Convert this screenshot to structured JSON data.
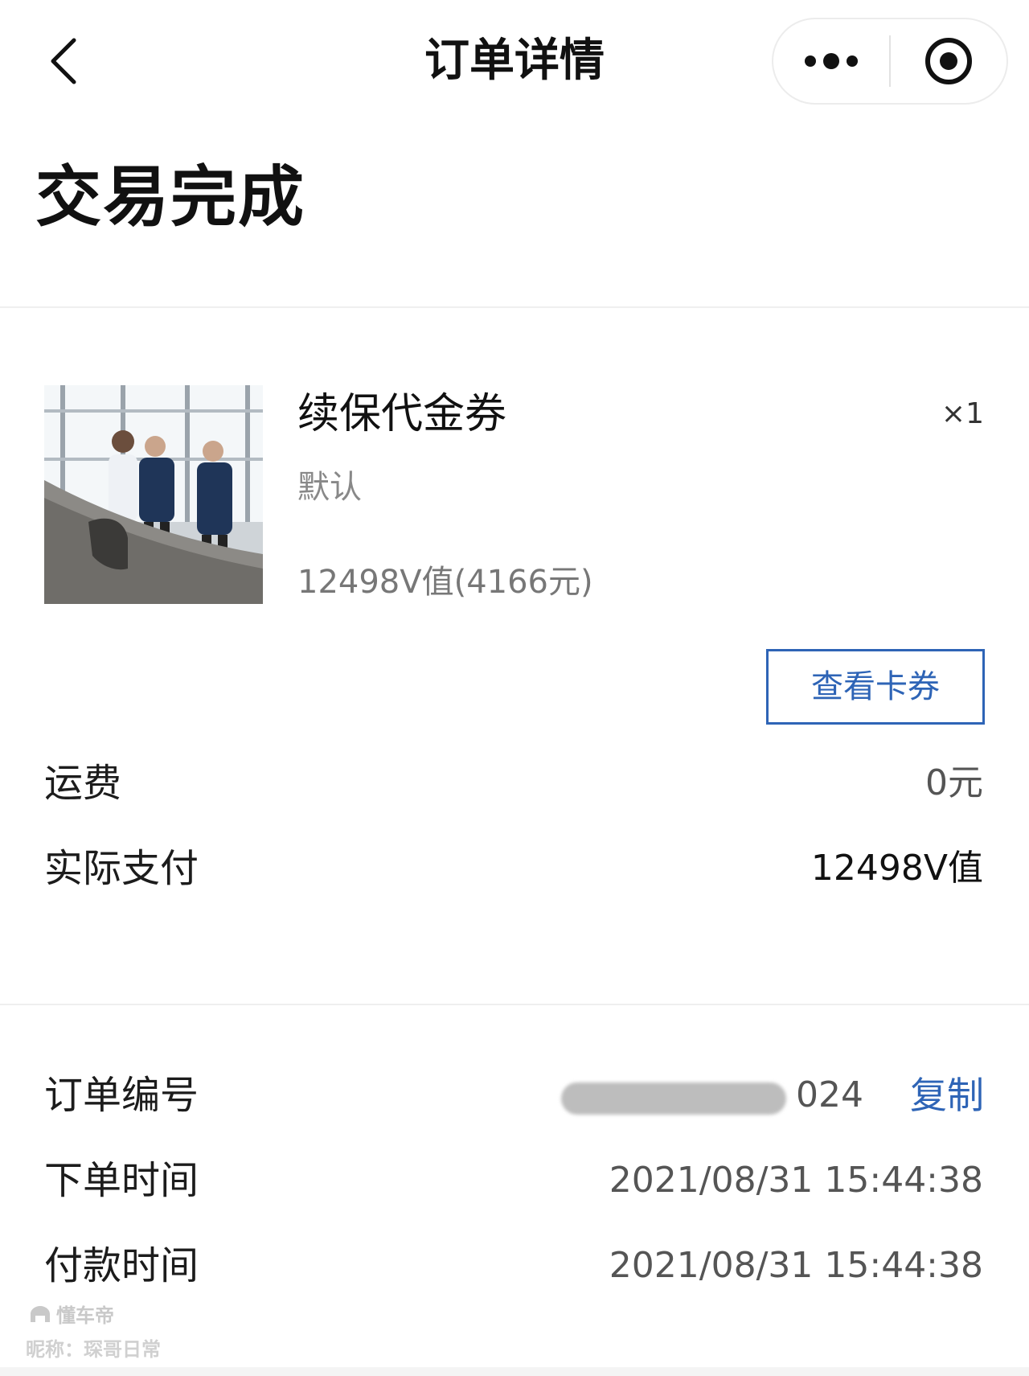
{
  "nav": {
    "title": "订单详情",
    "back_icon": "chevron-left-icon",
    "more_icon": "more-dots-icon",
    "close_icon": "target-circle-icon"
  },
  "status": {
    "title": "交易完成"
  },
  "product": {
    "name": "续保代金券",
    "quantity": "×1",
    "spec": "默认",
    "price": "12498V值(4166元)",
    "view_button": "查看卡券"
  },
  "summary": {
    "shipping_label": "运费",
    "shipping_value": "0元",
    "paid_label": "实际支付",
    "paid_value": "12498V值"
  },
  "order_info": {
    "order_no_label": "订单编号",
    "order_no_value": "024",
    "copy_label": "复制",
    "order_time_label": "下单时间",
    "order_time_value": "2021/08/31 15:44:38",
    "pay_time_label": "付款时间",
    "pay_time_value": "2021/08/31 15:44:38"
  },
  "watermark": {
    "brand": "懂车帝",
    "user": "昵称：琛哥日常"
  },
  "colors": {
    "accent": "#2e64b6",
    "text_primary": "#111111",
    "text_secondary": "#888888",
    "divider": "#efefef"
  }
}
